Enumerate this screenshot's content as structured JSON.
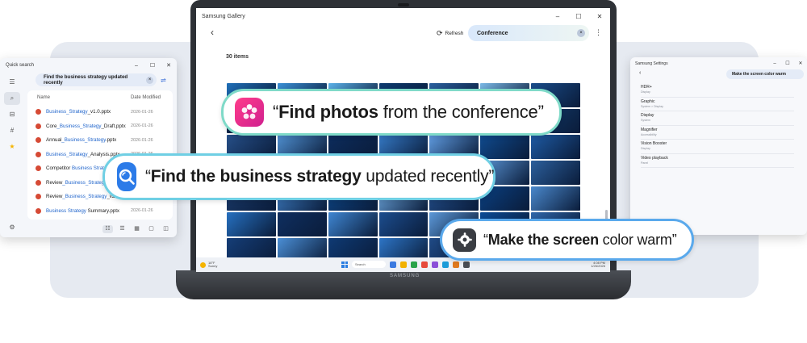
{
  "quick_search": {
    "title": "Quick search",
    "controls": [
      "–",
      "☐",
      "✕"
    ],
    "query": "Find the business strategy updated recently",
    "columns": {
      "name": "Name",
      "date": "Date Modified"
    },
    "rows": [
      {
        "pre": "",
        "hl": "Business_Strategy",
        "post": "_v1.0.pptx",
        "date": "2026-01-26"
      },
      {
        "pre": "Core",
        "hl": "_Business_Strategy",
        "post": "_Draft.pptx",
        "date": "2026-01-26"
      },
      {
        "pre": "Annual",
        "hl": "_Business_Strategy",
        "post": ".pptx",
        "date": "2026-01-26"
      },
      {
        "pre": "",
        "hl": "Business_Strategy",
        "post": "_Analysis.pptx",
        "date": "2026-01-26"
      },
      {
        "pre": "Competitor ",
        "hl": "Business Strateg",
        "post": "",
        "date": ""
      },
      {
        "pre": "Review",
        "hl": "_Business_Strateg",
        "post": "",
        "date": ""
      },
      {
        "pre": "Review",
        "hl": "_Business_Strategy",
        "post": "_v2",
        "date": ""
      },
      {
        "pre": "",
        "hl": "Business Strategy",
        "post": " Summary.pptx",
        "date": "2026-01-26"
      }
    ]
  },
  "settings": {
    "title": "Samsung Settings",
    "controls": [
      "–",
      "☐",
      "✕"
    ],
    "query": "Make the screen color warm",
    "items": [
      {
        "title": "HDR+",
        "sub": "Display"
      },
      {
        "title": "Graphic",
        "sub": "System > Display"
      },
      {
        "title": "Display",
        "sub": "System"
      },
      {
        "title": "Magnifier",
        "sub": "Accessibility"
      },
      {
        "title": "Vision Booster",
        "sub": "Display"
      },
      {
        "title": "Video playback",
        "sub": "Panel"
      }
    ]
  },
  "gallery": {
    "title": "Samsung Gallery",
    "controls": [
      "–",
      "☐",
      "✕"
    ],
    "refresh_label": "Refresh",
    "search_value": "Conference",
    "count": "30 items",
    "photos": [
      "#1f6fb8",
      "#3a8fd6",
      "#5ab0e8",
      "#0d3b70",
      "#2a5f9e",
      "#7ab8e6",
      "#1a4c8a",
      "#0e2a52",
      "#3e73b5",
      "#6aa4dc",
      "#1b3f75",
      "#0a64b8",
      "#2f86d0",
      "#123a6b",
      "#264f88",
      "#4f8fd0",
      "#0c2c5c",
      "#3478c4",
      "#5f9be0",
      "#0f4a8e",
      "#1e5aa3",
      "#2b69b2",
      "#0b3469",
      "#477fc4",
      "#18457f",
      "#0e57a8",
      "#5a95d6",
      "#2c5f9c",
      "#1a3a6a",
      "#3d7cc2",
      "#0d4585",
      "#6da8e0",
      "#234f8c",
      "#0a3f80",
      "#4a88cc",
      "#2670c0",
      "#0f2f60",
      "#3f86d2",
      "#1c4d8e",
      "#5c98d8",
      "#0b4b96",
      "#2e66aa",
      "#153e78",
      "#4b8fd6",
      "#0e3a74",
      "#2d75c6",
      "#1f4a86",
      "#5291d4",
      "#0d3370"
    ],
    "taskbar": {
      "weather_temp": "18°F",
      "weather_desc": "Sunny",
      "search_placeholder": "Search",
      "time": "4:08 PM",
      "date": "1/26/2026",
      "app_colors": [
        "#3b7ae0",
        "#f2b100",
        "#2aa34a",
        "#e64a3b",
        "#8a4fd8",
        "#1c9bd8",
        "#e07a1f",
        "#4a4e55"
      ]
    }
  },
  "laptop": {
    "brand": "SAMSUNG"
  },
  "callouts": {
    "gallery": {
      "bold": "Find photos",
      "rest": " from the conference"
    },
    "search": {
      "bold": "Find the business strategy",
      "rest": " updated recently"
    },
    "settings": {
      "bold": "Make the screen",
      "rest": " color warm"
    }
  },
  "colors": {
    "accent_blue": "#2266cc",
    "pill_teal": "#7fdac8",
    "pill_cyan": "#6fcfe4",
    "pill_blue": "#5aa9ec",
    "gallery_icon": "#e0278f",
    "search_icon": "#2c7be8",
    "settings_icon": "#3a3d43"
  }
}
